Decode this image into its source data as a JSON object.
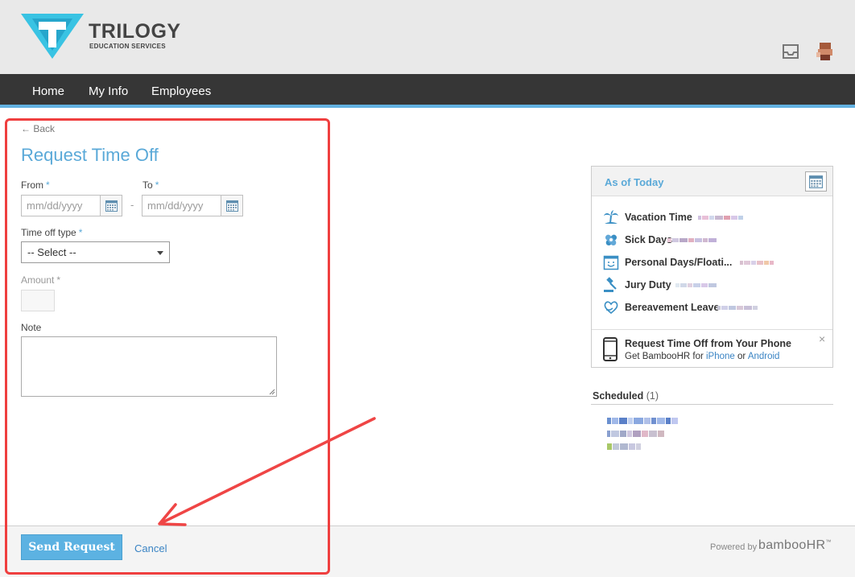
{
  "header": {
    "brand_name": "TRILOGY",
    "brand_sub": "EDUCATION SERVICES",
    "icons": [
      "inbox-icon",
      "avatar"
    ]
  },
  "nav": {
    "items": [
      {
        "label": "Home"
      },
      {
        "label": "My Info"
      },
      {
        "label": "Employees"
      }
    ]
  },
  "form": {
    "back_label": "Back",
    "title": "Request Time Off",
    "from_label": "From",
    "to_label": "To",
    "required_mark": "*",
    "from_placeholder": "mm/dd/yyyy",
    "to_placeholder": "mm/dd/yyyy",
    "range_dash": "-",
    "type_label": "Time off type",
    "type_selected": "-- Select --",
    "amount_label": "Amount",
    "note_label": "Note"
  },
  "footer": {
    "send_label": "Send Request",
    "cancel_label": "Cancel",
    "powered_label": "Powered by",
    "vendor_name": "bambooHR",
    "vendor_mark": "™"
  },
  "balances": {
    "title": "As of Today",
    "items": [
      {
        "name": "Vacation Time",
        "icon": "palm-tree-icon"
      },
      {
        "name": "Sick Days",
        "icon": "bandage-icon"
      },
      {
        "name": "Personal Days/Floati...",
        "icon": "calendar-smile-icon"
      },
      {
        "name": "Jury Duty",
        "icon": "gavel-icon"
      },
      {
        "name": "Bereavement Leave",
        "icon": "heart-hand-icon"
      }
    ],
    "phone_title": "Request Time Off from Your Phone",
    "phone_sub_prefix": "Get BambooHR for",
    "phone_iphone": "iPhone",
    "phone_or": "or",
    "phone_android": "Android",
    "close_glyph": "×"
  },
  "scheduled": {
    "title": "Scheduled",
    "count": "(1)"
  },
  "colors": {
    "accent": "#5aa9d8",
    "nav_bg": "#363636",
    "nav_underline": "#62b1e1",
    "button": "#5cb2e2",
    "annotation": "#ef3f3f"
  }
}
